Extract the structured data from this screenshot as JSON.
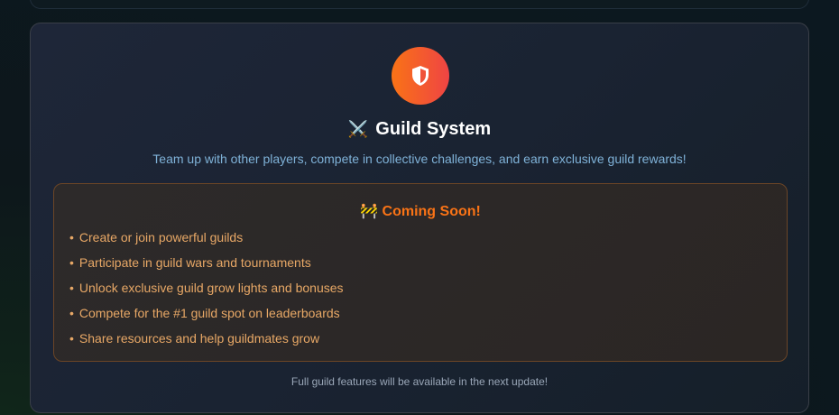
{
  "guild": {
    "icon": "shield-icon",
    "title_emoji": "⚔️",
    "title": "Guild System",
    "subtitle": "Team up with other players, compete in collective challenges, and earn exclusive guild rewards!",
    "coming_soon": {
      "emoji": "🚧",
      "heading": "Coming Soon!",
      "features": [
        "Create or join powerful guilds",
        "Participate in guild wars and tournaments",
        "Unlock exclusive guild grow lights and bonuses",
        "Compete for the #1 guild spot on leaderboards",
        "Share resources and help guildmates grow"
      ]
    },
    "footer": "Full guild features will be available in the next update!"
  },
  "colors": {
    "accent_start": "#f97316",
    "accent_end": "#ef4444",
    "feature_text": "#e8a866"
  }
}
